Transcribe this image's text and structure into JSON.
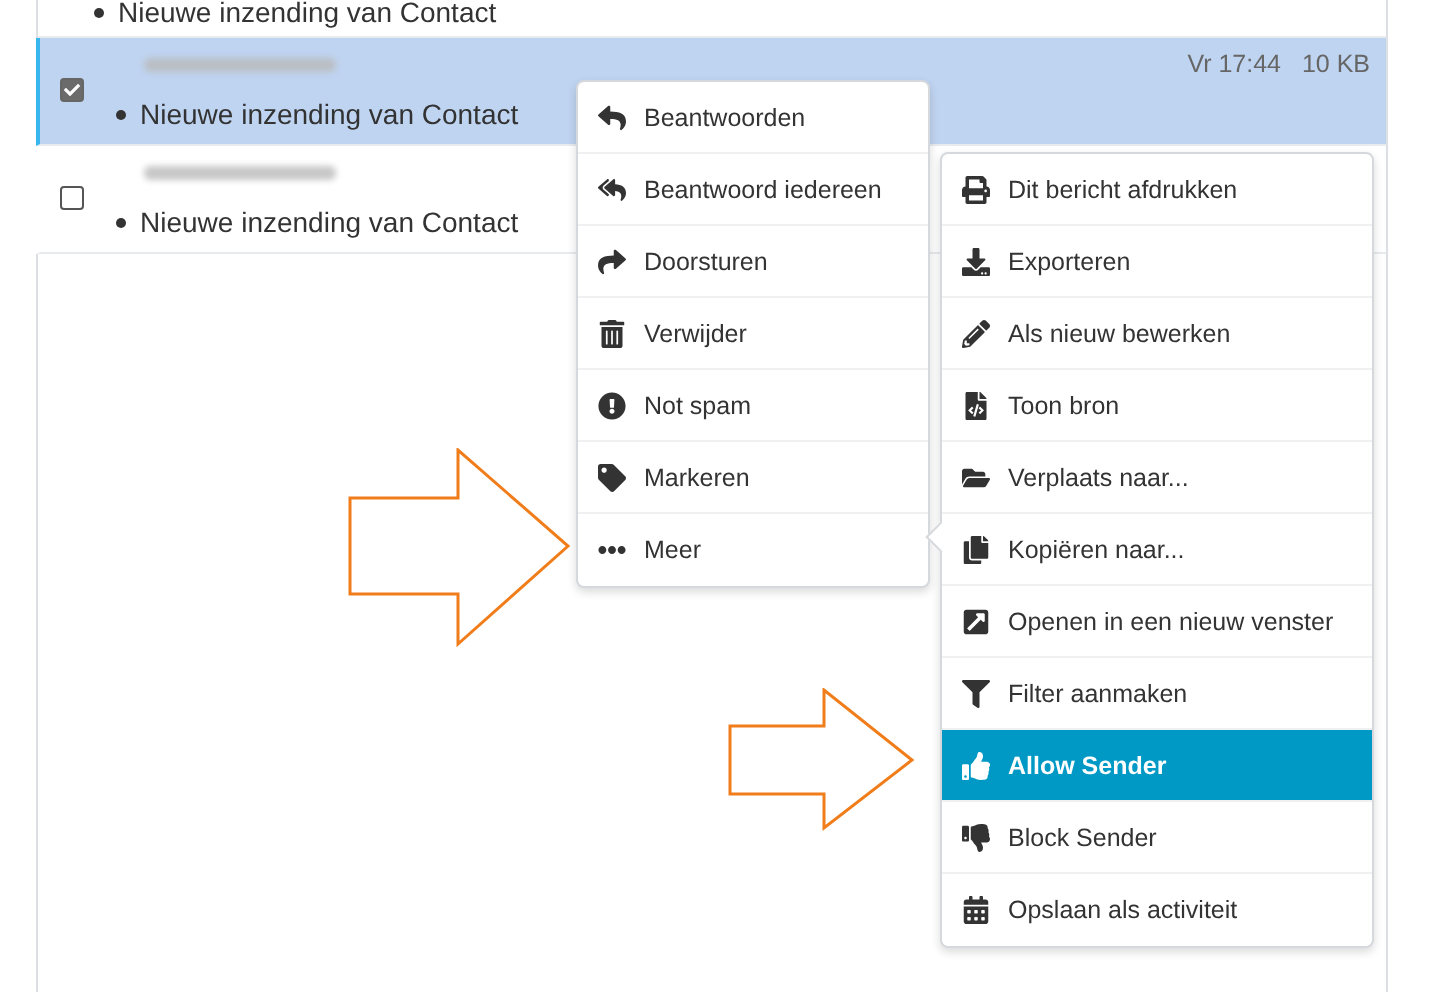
{
  "messages": [
    {
      "kind": "partial",
      "subject": "Nieuwe inzending van Contact"
    },
    {
      "kind": "full",
      "subject": "Nieuwe inzending van Contact",
      "selected": true,
      "date": "Vr 17:44",
      "size": "10 KB"
    },
    {
      "kind": "full",
      "subject": "Nieuwe inzending van Contact",
      "selected": false
    }
  ],
  "context_menu": {
    "items": [
      {
        "label": "Beantwoorden",
        "selected": false
      },
      {
        "label": "Beantwoord iedereen",
        "selected": false
      },
      {
        "label": "Doorsturen",
        "selected": false
      },
      {
        "label": "Verwijder",
        "selected": false
      },
      {
        "label": "Not spam",
        "selected": false
      },
      {
        "label": "Markeren",
        "selected": false
      },
      {
        "label": "Meer",
        "selected": false
      }
    ]
  },
  "submenu": {
    "items": [
      {
        "label": "Dit bericht afdrukken",
        "selected": false
      },
      {
        "label": "Exporteren",
        "selected": false
      },
      {
        "label": "Als nieuw bewerken",
        "selected": false
      },
      {
        "label": "Toon bron",
        "selected": false
      },
      {
        "label": "Verplaats naar...",
        "selected": false
      },
      {
        "label": "Kopiëren naar...",
        "selected": false
      },
      {
        "label": "Openen in een nieuw venster",
        "selected": false
      },
      {
        "label": "Filter aanmaken",
        "selected": false
      },
      {
        "label": "Allow Sender",
        "selected": true
      },
      {
        "label": "Block Sender",
        "selected": false
      },
      {
        "label": "Opslaan als activiteit",
        "selected": false
      }
    ]
  }
}
